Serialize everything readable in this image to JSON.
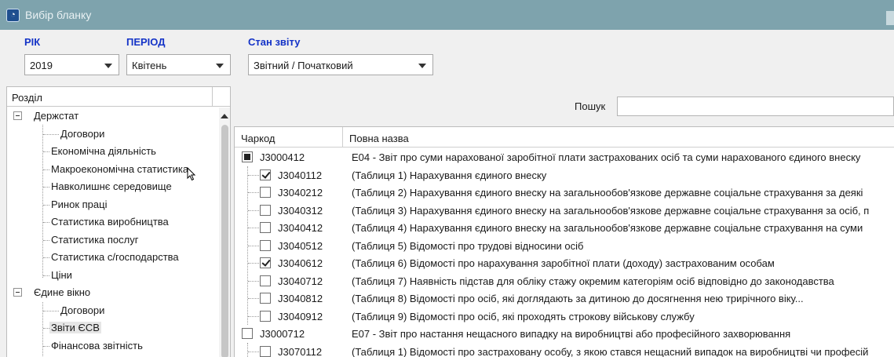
{
  "window": {
    "title": "Вибір бланку"
  },
  "filters": {
    "year": {
      "label": "РІК",
      "value": "2019"
    },
    "period": {
      "label": "ПЕРІОД",
      "value": "Квітень"
    },
    "status": {
      "label": "Стан звіту",
      "value": "Звітний / Початковий"
    }
  },
  "tree": {
    "header": "Розділ",
    "items": [
      {
        "label": "Держстат",
        "level": 0,
        "expanded": true
      },
      {
        "label": "Договори",
        "level": 1
      },
      {
        "label": "Економічна діяльність",
        "level": 1
      },
      {
        "label": "Макроекономічна статистика",
        "level": 1
      },
      {
        "label": "Навколишнє середовище",
        "level": 1
      },
      {
        "label": "Ринок праці",
        "level": 1
      },
      {
        "label": "Статистика виробництва",
        "level": 1
      },
      {
        "label": "Статистика послуг",
        "level": 1
      },
      {
        "label": "Статистика с/господарства",
        "level": 1
      },
      {
        "label": "Ціни",
        "level": 1
      },
      {
        "label": "Єдине вікно",
        "level": 0,
        "expanded": true
      },
      {
        "label": "Договори",
        "level": 1
      },
      {
        "label": "Звіти ЄСВ",
        "level": 1,
        "selected": true
      },
      {
        "label": "Фінансова звітність",
        "level": 1
      }
    ]
  },
  "search": {
    "label": "Пошук",
    "value": ""
  },
  "grid": {
    "columns": [
      "Чаркод",
      "Повна назва"
    ],
    "rows": [
      {
        "code": "J3000412",
        "name": "Е04 - Звіт про суми нарахованої заробітної плати застрахованих осіб та суми нарахованого єдиного внеску",
        "level": 0,
        "state": "partial"
      },
      {
        "code": "J3040112",
        "name": "(Таблиця 1) Нарахування єдиного внеску",
        "level": 1,
        "state": "checked"
      },
      {
        "code": "J3040212",
        "name": "(Таблиця 2) Нарахування єдиного внеску на загальнообов'язкове державне соціальне страхування за деякі",
        "level": 1,
        "state": "unchecked"
      },
      {
        "code": "J3040312",
        "name": "(Таблиця 3) Нарахування єдиного внеску на загальнообов'язкове державне соціальне страхування за осіб, п",
        "level": 1,
        "state": "unchecked"
      },
      {
        "code": "J3040412",
        "name": "(Таблиця 4) Нарахування єдиного внеску на загальнообов'язкове державне соціальне страхування на суми",
        "level": 1,
        "state": "unchecked"
      },
      {
        "code": "J3040512",
        "name": "(Таблиця 5) Відомості про трудові відносини осіб",
        "level": 1,
        "state": "unchecked"
      },
      {
        "code": "J3040612",
        "name": "(Таблиця 6) Відомості про нарахування заробітної плати (доходу) застрахованим особам",
        "level": 1,
        "state": "checked"
      },
      {
        "code": "J3040712",
        "name": "(Таблиця 7) Наявність підстав для обліку стажу окремим категоріям осіб відповідно до законодавства",
        "level": 1,
        "state": "unchecked"
      },
      {
        "code": "J3040812",
        "name": "(Таблиця 8) Відомості про осіб, які доглядають за дитиною до досягнення нею трирічного віку...",
        "level": 1,
        "state": "unchecked"
      },
      {
        "code": "J3040912",
        "name": "(Таблиця 9) Відомості про осіб, які проходять строкову військову службу",
        "level": 1,
        "state": "unchecked"
      },
      {
        "code": "J3000712",
        "name": "Е07 - Звіт про настання нещасного випадку на виробництві або професійного захворювання",
        "level": 0,
        "state": "unchecked"
      },
      {
        "code": "J3070112",
        "name": "(Таблиця 1) Відомості про застраховану особу, з якою стався нещасний випадок на виробництві чи професій",
        "level": 1,
        "state": "unchecked"
      }
    ]
  }
}
